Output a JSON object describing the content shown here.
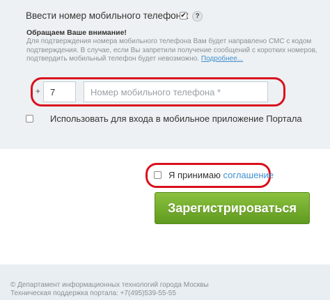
{
  "mobile": {
    "label": "Ввести номер мобильного телефона:",
    "checkbox_mark": "✔",
    "help_icon": "?",
    "notice_title": "Обращаем Ваше внимание!",
    "notice_text": "Для подтверждения номера мобильного телефона Вам будет направлено СМС с кодом подтверждения. В случае, если Вы запретили получение сообщений с коротких номеров, подтвердить мобильный телефон будет невозможно. ",
    "notice_link": "Подробнее...",
    "plus": "+",
    "country_code": "7",
    "phone_placeholder": "Номер мобильного телефона *",
    "app_login_label": "Использовать для входа в мобильное приложение Портала"
  },
  "agreement": {
    "prefix": "Я принимаю ",
    "link": "соглашение"
  },
  "register_button": "Зарегистрироваться",
  "footer": {
    "line1": "© Департамент информационных технологий города Москвы",
    "line2": "Техническая поддержка портала: +7(495)539-55-55"
  },
  "colors": {
    "highlight_ring": "#d9101d",
    "button_green": "#6fac2a",
    "link": "#3f8fcf"
  }
}
